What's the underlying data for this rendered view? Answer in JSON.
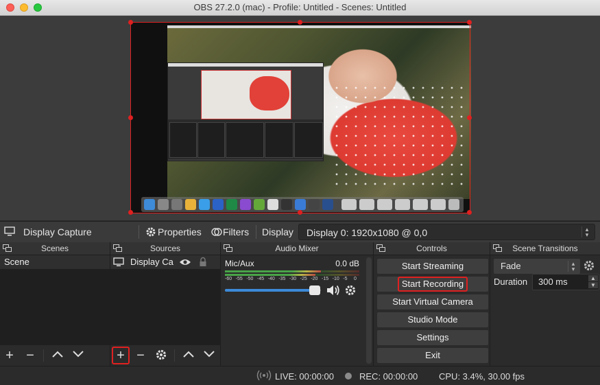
{
  "window": {
    "title": "OBS 27.2.0 (mac) - Profile: Untitled - Scenes: Untitled"
  },
  "source_toolbar": {
    "source_name": "Display Capture",
    "properties_label": "Properties",
    "filters_label": "Filters",
    "display_label": "Display",
    "display_value": "Display 0: 1920x1080 @ 0,0"
  },
  "scenes": {
    "title": "Scenes",
    "items": [
      "Scene"
    ]
  },
  "sources": {
    "title": "Sources",
    "items": [
      {
        "name": "Display Ca"
      }
    ]
  },
  "audio_mixer": {
    "title": "Audio Mixer",
    "channel_name": "Mic/Aux",
    "level": "0.0 dB",
    "scale": [
      "-60",
      "-55",
      "-50",
      "-45",
      "-40",
      "-35",
      "-30",
      "-25",
      "-20",
      "-15",
      "-10",
      "-5",
      "0"
    ],
    "volume_fraction": 0.95
  },
  "controls": {
    "title": "Controls",
    "buttons": [
      "Start Streaming",
      "Start Recording",
      "Start Virtual Camera",
      "Studio Mode",
      "Settings",
      "Exit"
    ],
    "highlight_color": "#e02020"
  },
  "transitions": {
    "title": "Scene Transitions",
    "transition": "Fade",
    "duration_label": "Duration",
    "duration_value": "300 ms"
  },
  "status": {
    "live": "LIVE: 00:00:00",
    "rec": "REC: 00:00:00",
    "cpu": "CPU: 3.4%, 30.00 fps"
  },
  "colors": {
    "panel_bg": "#2b2b2b",
    "list_bg": "#1f1f1f",
    "selection_red": "#e02020"
  },
  "icons": {
    "monitor": "monitor-icon",
    "gear": "gear-icon",
    "filters": "filters-icon",
    "eye": "eye-icon",
    "lock": "lock-icon",
    "speaker": "speaker-icon",
    "plus": "plus-icon",
    "minus": "minus-icon",
    "up": "arrow-up-icon",
    "down": "arrow-down-icon",
    "broadcast": "broadcast-icon",
    "record": "record-dot-icon"
  }
}
